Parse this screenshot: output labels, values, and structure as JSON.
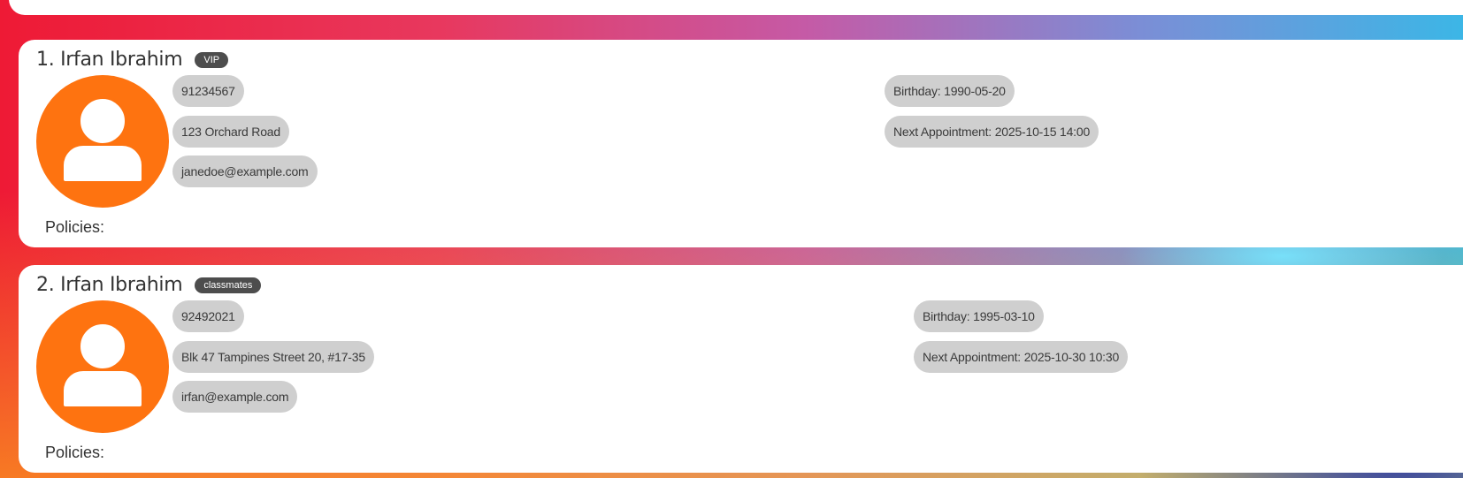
{
  "persons": [
    {
      "index_name": "1. Irfan Ibrahim",
      "tag": "VIP",
      "phone": "91234567",
      "address": "123 Orchard Road",
      "email": "janedoe@example.com",
      "birthday": "Birthday: 1990-05-20",
      "appointment": "Next Appointment: 2025-10-15 14:00",
      "policies_label": "Policies:"
    },
    {
      "index_name": "2. Irfan Ibrahim",
      "tag": "classmates",
      "phone": "92492021",
      "address": "Blk 47 Tampines Street 20, #17-35",
      "email": "irfan@example.com",
      "birthday": "Birthday: 1995-03-10",
      "appointment": "Next Appointment: 2025-10-30 10:30",
      "policies_label": "Policies:"
    }
  ],
  "colors": {
    "avatar": "#fe7310",
    "chip": "#cfcfcf",
    "tag": "#4d4d4d"
  },
  "icons": {
    "avatar": "person-avatar-icon"
  }
}
